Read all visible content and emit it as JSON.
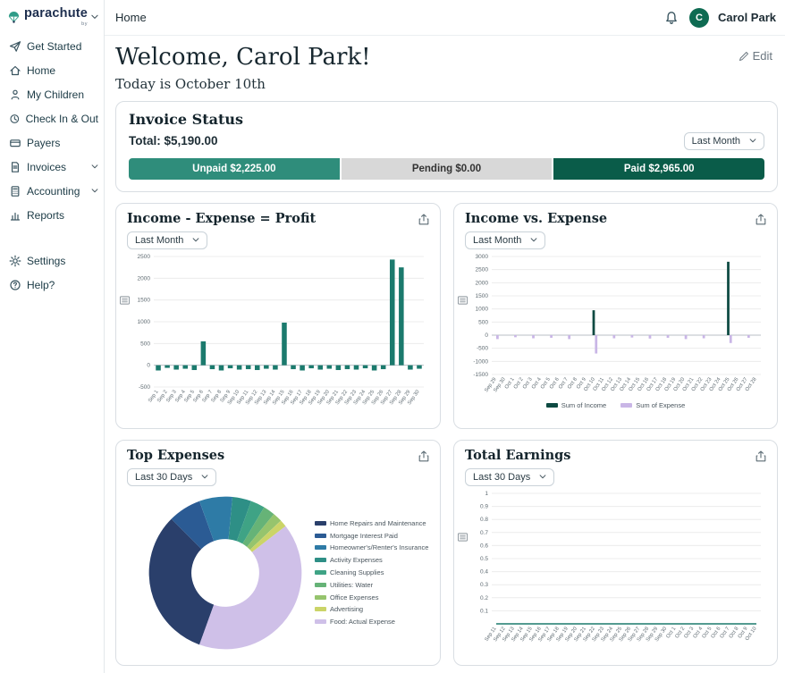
{
  "brand": {
    "name": "parachute",
    "tagline": "by"
  },
  "topbar": {
    "nav_home": "Home",
    "user_name": "Carol Park",
    "avatar_initial": "C"
  },
  "sidebar": {
    "items": [
      {
        "label": "Get Started"
      },
      {
        "label": "Home"
      },
      {
        "label": "My Children"
      },
      {
        "label": "Check In & Out"
      },
      {
        "label": "Payers"
      },
      {
        "label": "Invoices",
        "expandable": true
      },
      {
        "label": "Accounting",
        "expandable": true
      },
      {
        "label": "Reports"
      },
      {
        "label": "Settings"
      },
      {
        "label": "Help?"
      }
    ]
  },
  "welcome": {
    "title": "Welcome, Carol Park!",
    "subtitle": "Today is October 10th",
    "edit_label": "Edit"
  },
  "invoice_status": {
    "title": "Invoice Status",
    "total_label": "Total: $5,190.00",
    "period": "Last Month",
    "segments": [
      {
        "label": "Unpaid $2,225.00",
        "color": "#2F8D7B"
      },
      {
        "label": "Pending $0.00",
        "color": "#D8D8D8"
      },
      {
        "label": "Paid $2,965.00",
        "color": "#0A5C49"
      }
    ]
  },
  "chart_data": [
    {
      "type": "bar",
      "title": "Income - Expense = Profit",
      "period": "Last Month",
      "color": "#1B7A6D",
      "ylim": [
        -500,
        2500
      ],
      "yticks": [
        -500,
        0,
        500,
        1000,
        1500,
        2000,
        2500
      ],
      "categories": [
        "Sep 1",
        "Sep 2",
        "Sep 3",
        "Sep 4",
        "Sep 5",
        "Sep 6",
        "Sep 7",
        "Sep 8",
        "Sep 9",
        "Sep 10",
        "Sep 11",
        "Sep 12",
        "Sep 13",
        "Sep 14",
        "Sep 15",
        "Sep 16",
        "Sep 17",
        "Sep 18",
        "Sep 19",
        "Sep 20",
        "Sep 21",
        "Sep 22",
        "Sep 23",
        "Sep 24",
        "Sep 25",
        "Sep 26",
        "Sep 27",
        "Sep 28",
        "Sep 29",
        "Sep 30"
      ],
      "values": [
        -120,
        -60,
        -100,
        -80,
        -110,
        550,
        -90,
        -120,
        -70,
        -100,
        -90,
        -110,
        -80,
        -100,
        980,
        -90,
        -120,
        -70,
        -100,
        -80,
        -110,
        -90,
        -100,
        -70,
        -120,
        -90,
        2430,
        2250,
        -100,
        -80
      ]
    },
    {
      "type": "bar",
      "title": "Income vs. Expense",
      "period": "Last Month",
      "ylim": [
        -1500,
        3000
      ],
      "yticks": [
        -1500,
        -1000,
        -500,
        0,
        500,
        1000,
        1500,
        2000,
        2500,
        3000
      ],
      "categories": [
        "Sep 29",
        "Sep 30",
        "Oct 1",
        "Oct 2",
        "Oct 3",
        "Oct 4",
        "Oct 5",
        "Oct 6",
        "Oct 7",
        "Oct 8",
        "Oct 9",
        "Oct 10",
        "Oct 11",
        "Oct 12",
        "Oct 13",
        "Oct 14",
        "Oct 15",
        "Oct 16",
        "Oct 17",
        "Oct 18",
        "Oct 19",
        "Oct 20",
        "Oct 21",
        "Oct 22",
        "Oct 23",
        "Oct 24",
        "Oct 25",
        "Oct 26",
        "Oct 27",
        "Oct 28"
      ],
      "series": [
        {
          "name": "Sum of Income",
          "color": "#0D4A42",
          "values": [
            0,
            0,
            0,
            0,
            0,
            0,
            0,
            0,
            0,
            0,
            0,
            950,
            0,
            0,
            0,
            0,
            0,
            0,
            0,
            0,
            0,
            0,
            0,
            0,
            0,
            0,
            2800,
            0,
            0,
            0
          ]
        },
        {
          "name": "Sum of Expense",
          "color": "#C9B6E6",
          "values": [
            -150,
            0,
            -80,
            0,
            -120,
            0,
            -100,
            0,
            -150,
            0,
            0,
            -700,
            0,
            -120,
            0,
            -90,
            0,
            -130,
            0,
            -100,
            0,
            -150,
            0,
            -120,
            0,
            0,
            -300,
            0,
            -100,
            0
          ]
        }
      ],
      "legend": "bottom"
    },
    {
      "type": "donut",
      "title": "Top Expenses",
      "period": "Last 30 Days",
      "start_fraction": 0.555,
      "slices": [
        {
          "label": "Home Repairs and Maintenance",
          "color": "#2A3F6B",
          "value": 32
        },
        {
          "label": "Mortgage Interest Paid",
          "color": "#2B5B94",
          "value": 7
        },
        {
          "label": "Homeowner's/Renter's Insurance",
          "color": "#2E7BA6",
          "value": 7
        },
        {
          "label": "Activity Expenses",
          "color": "#2E8F86",
          "value": 4
        },
        {
          "label": "Cleaning Supplies",
          "color": "#3FA385",
          "value": 3
        },
        {
          "label": "Utilities: Water",
          "color": "#66B377",
          "value": 2.5
        },
        {
          "label": "Office Expenses",
          "color": "#96C46D",
          "value": 2
        },
        {
          "label": "Advertising",
          "color": "#CBD468",
          "value": 1.5
        },
        {
          "label": "Food: Actual Expense",
          "color": "#CFC0E8",
          "value": 41
        }
      ]
    },
    {
      "type": "line",
      "title": "Total Earnings",
      "period": "Last 30 Days",
      "color": "#1B7A6D",
      "ylim": [
        0,
        1
      ],
      "yticks": [
        0.1,
        0.2,
        0.3,
        0.4,
        0.5,
        0.6,
        0.7,
        0.8,
        0.9,
        1
      ],
      "categories": [
        "Sep 11",
        "Sep 12",
        "Sep 13",
        "Sep 14",
        "Sep 15",
        "Sep 16",
        "Sep 17",
        "Sep 18",
        "Sep 19",
        "Sep 20",
        "Sep 21",
        "Sep 22",
        "Sep 23",
        "Sep 24",
        "Sep 25",
        "Sep 26",
        "Sep 27",
        "Sep 28",
        "Sep 29",
        "Sep 30",
        "Oct 1",
        "Oct 2",
        "Oct 3",
        "Oct 4",
        "Oct 5",
        "Oct 6",
        "Oct 7",
        "Oct 8",
        "Oct 9",
        "Oct 10"
      ],
      "values": [
        0,
        0,
        0,
        0,
        0,
        0,
        0,
        0,
        0,
        0,
        0,
        0,
        0,
        0,
        0,
        0,
        0,
        0,
        0,
        0,
        0,
        0,
        0,
        0,
        0,
        0,
        0,
        0,
        0,
        0
      ]
    }
  ],
  "theme": {
    "accent_teal": "#2F8D7B",
    "dark_green": "#0A5C49",
    "pending_gray": "#D8D8D8",
    "bar_teal": "#1B7A6D",
    "income_dark": "#0D4A42",
    "expense_lavender": "#C9B6E6",
    "brand_navy": "#1D2E4E"
  },
  "icons": {
    "brand": "parachute-icon",
    "topbar": [
      "bell-icon"
    ],
    "sidebar": [
      "paper-plane-icon",
      "home-icon",
      "child-icon",
      "clock-icon",
      "wallet-icon",
      "invoice-icon",
      "calculator-icon",
      "report-icon",
      "gear-icon",
      "help-icon"
    ],
    "cards": [
      "export-icon",
      "chart-menu-icon"
    ],
    "misc": [
      "pencil-icon",
      "chevron-down-icon"
    ]
  }
}
